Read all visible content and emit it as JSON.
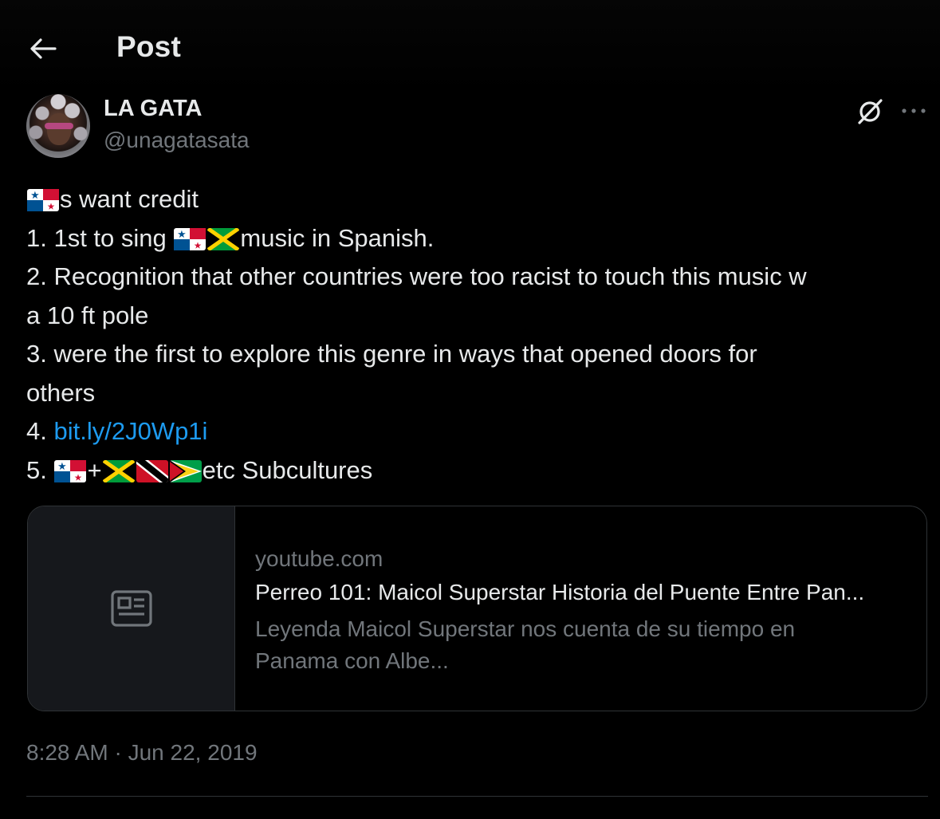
{
  "header": {
    "title": "Post",
    "back_icon": "back-arrow-icon"
  },
  "author": {
    "display_name": "LA GATA",
    "handle": "@unagatasata",
    "avatar": "avatar-photo"
  },
  "actions": {
    "grok_icon": "grok-icon",
    "more_icon": "more-icon"
  },
  "tweet": {
    "line1_suffix": "s want credit",
    "line2_prefix": "1. 1st to sing ",
    "line2_suffix": "music in Spanish.",
    "line3": "2. Recognition that other countries were too racist to touch this music w",
    "line4": "a 10 ft pole",
    "line5": "3. were the first to explore this genre in ways that opened doors for",
    "line6": "others",
    "line7_prefix": "4. ",
    "link": "bit.ly/2J0Wp1i",
    "line8_prefix": "5. ",
    "line8_plus": "+",
    "line8_suffix": "etc Subcultures",
    "flags": [
      "panama",
      "jamaica",
      "trinidad-and-tobago",
      "guyana"
    ]
  },
  "card": {
    "icon": "article-icon",
    "domain": "youtube.com",
    "title": "Perreo 101: Maicol Superstar Historia del Puente Entre Pan...",
    "description_line1": "Leyenda Maicol Superstar nos cuenta de su tiempo en",
    "description_line2": "Panama con Albe..."
  },
  "timestamp": "8:28 AM · Jun 22, 2019",
  "colors": {
    "background": "#000000",
    "text": "#e7e9ea",
    "muted": "#71767b",
    "link": "#1d9bf0",
    "border": "#2f3336"
  }
}
